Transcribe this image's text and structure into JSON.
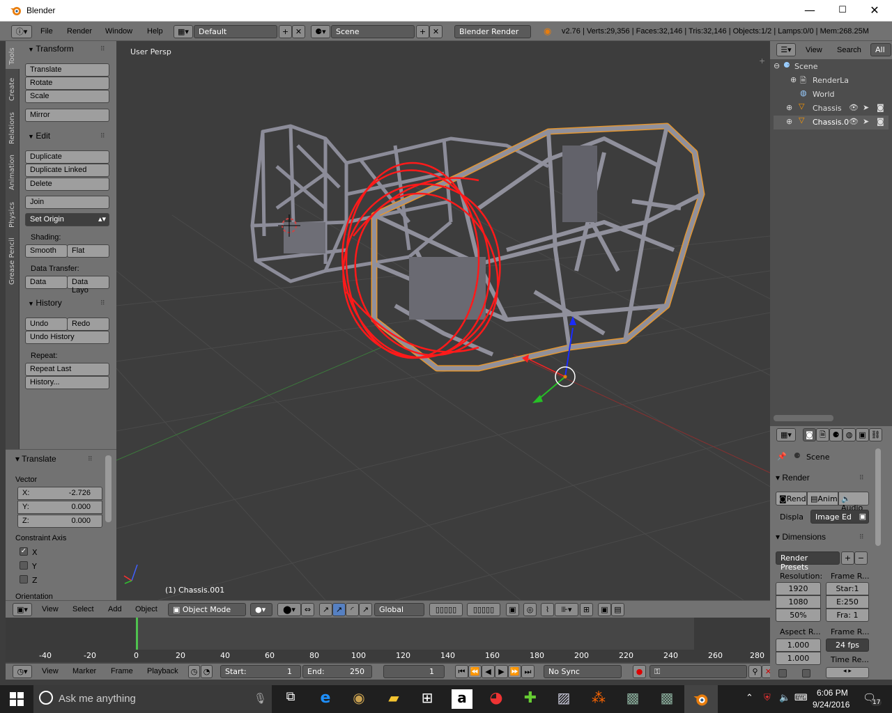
{
  "window": {
    "title": "Blender",
    "min_label": "—",
    "max_label": "☐",
    "close_label": "✕"
  },
  "topbar": {
    "menus": [
      "File",
      "Render",
      "Window",
      "Help"
    ],
    "layout": "Default",
    "scene": "Scene",
    "engine": "Blender Render",
    "status": "v2.76 | Verts:29,356 | Faces:32,146 | Tris:32,146 | Objects:1/2 | Lamps:0/0 | Mem:268.25M"
  },
  "tool_tabs": [
    "Tools",
    "Create",
    "Relations",
    "Animation",
    "Physics",
    "Grease Pencil"
  ],
  "toolshelf": {
    "transform": {
      "title": "Transform",
      "buttons": [
        "Translate",
        "Rotate",
        "Scale",
        "Mirror"
      ]
    },
    "edit": {
      "title": "Edit",
      "buttons": [
        "Duplicate",
        "Duplicate Linked",
        "Delete",
        "Join"
      ],
      "set_origin": "Set Origin",
      "shading_label": "Shading:",
      "smooth": "Smooth",
      "flat": "Flat",
      "data_transfer_label": "Data Transfer:",
      "data": "Data",
      "data_layout": "Data Layo"
    },
    "history": {
      "title": "History",
      "undo": "Undo",
      "redo": "Redo",
      "undo_history": "Undo History",
      "repeat_label": "Repeat:",
      "repeat_last": "Repeat Last",
      "history": "History..."
    }
  },
  "operator": {
    "title": "Translate",
    "vector_label": "Vector",
    "x_label": "X:",
    "x_value": "-2.726",
    "y_label": "Y:",
    "y_value": "0.000",
    "z_label": "Z:",
    "z_value": "0.000",
    "constraint_label": "Constraint Axis",
    "axes": [
      "X",
      "Y",
      "Z"
    ],
    "orientation_label": "Orientation"
  },
  "viewport": {
    "view_name": "User Persp",
    "object_label": "(1) Chassis.001",
    "accent_red": "#ff1a1a",
    "selection_orange": "#e39631"
  },
  "view_header": {
    "menus": [
      "View",
      "Select",
      "Add",
      "Object"
    ],
    "mode": "Object Mode",
    "orientation": "Global"
  },
  "timeline": {
    "ruler": [
      "-40",
      "-20",
      "0",
      "20",
      "40",
      "60",
      "80",
      "100",
      "120",
      "140",
      "160",
      "180",
      "200",
      "220",
      "240",
      "260",
      "280"
    ],
    "menus": [
      "View",
      "Marker",
      "Frame",
      "Playback"
    ],
    "start_label": "Start:",
    "start_value": "1",
    "end_label": "End:",
    "end_value": "250",
    "current": "1",
    "sync": "No Sync"
  },
  "outliner": {
    "menus": [
      "View",
      "Search"
    ],
    "filter": "All",
    "items": [
      {
        "label": "Scene"
      },
      {
        "label": "RenderLa"
      },
      {
        "label": "World"
      },
      {
        "label": "Chassis"
      },
      {
        "label": "Chassis.0"
      }
    ]
  },
  "properties": {
    "scene": "Scene",
    "render_title": "Render",
    "render_btn": "Rend",
    "anim_btn": "Anim",
    "audio_btn": "Audio",
    "display_label": "Displa",
    "display_value": "Image Ed",
    "dimensions_title": "Dimensions",
    "presets": "Render Presets",
    "resolution_label": "Resolution:",
    "res_x": "1920",
    "res_y": "1080",
    "res_pct": "50%",
    "frame_range_label": "Frame R...",
    "start": "Star:1",
    "end": "E:250",
    "step": "Fra: 1",
    "aspect_label": "Aspect R...",
    "aspect_x": "1.000",
    "aspect_y": "1.000",
    "frame_rate_label": "Frame R...",
    "fps": "24 fps",
    "time_label": "Time Re..."
  },
  "taskbar": {
    "search_placeholder": "Ask me anything",
    "time": "6:06 PM",
    "date": "9/24/2016",
    "notif": "17"
  }
}
